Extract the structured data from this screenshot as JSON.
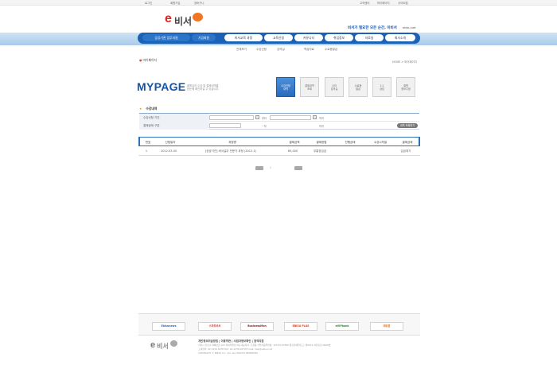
{
  "top_links": [
    "로그인",
    "회원가입",
    "장바구니",
    "고객센터",
    "마이페이지",
    "사이트맵"
  ],
  "brand": {
    "logo_e": "e",
    "logo_name": "비서"
  },
  "slogan": "비서가 필요한 모든 순간, 이비서",
  "slogan_sub": "ebisu.net",
  "nav": [
    {
      "label": "공공기관 업무지원",
      "style": "dark"
    },
    {
      "label": "기업회원",
      "style": "dark"
    },
    {
      "label": "비서교육 과정",
      "style": "light"
    },
    {
      "label": "교육신청",
      "style": "light"
    },
    {
      "label": "커뮤니티",
      "style": "light"
    },
    {
      "label": "취업정보",
      "style": "light"
    },
    {
      "label": "자료실",
      "style": "light"
    },
    {
      "label": "회사소개",
      "style": "light"
    }
  ],
  "subnav": [
    "전체보기",
    "수강신청",
    "강의실",
    "학습자료",
    "수료증발급"
  ],
  "breadcrumb": {
    "left": "마이페이지",
    "right": "HOME > 마이페이지"
  },
  "page": {
    "title": "MYPAGE",
    "desc_line1": "회원님의 수강 및 결제내역을",
    "desc_line2": "한눈에 확인하실 수 있습니다."
  },
  "tiles": [
    {
      "label1": "수강신청",
      "label2": "내역",
      "active": true
    },
    {
      "label1": "결제내역",
      "label2": "조회",
      "active": false
    },
    {
      "label1": "나의",
      "label2": "강의실",
      "active": false
    },
    {
      "label1": "수료증",
      "label2": "발급",
      "active": false
    },
    {
      "label1": "1:1",
      "label2": "상담",
      "active": false
    },
    {
      "label1": "회원",
      "label2": "정보수정",
      "active": false
    }
  ],
  "search": {
    "title": "수강내역",
    "row1_label": "수강신청 기간",
    "row1_from": "부터",
    "row1_to": "까지",
    "row2_label": "결제상태 구분",
    "row2_mid": "~부",
    "row2_end": "까지",
    "search_button": "내역 조회하기"
  },
  "table": {
    "headers": [
      "번호",
      "신청일자",
      "과정명",
      "결제금액",
      "결제방법",
      "진행상태",
      "수강시작일",
      "결제상태"
    ],
    "rows": [
      [
        "1",
        "2012.03.05",
        "[공공기관] 비서실무 전문가 과정 (2012-1)",
        "85,000",
        "무통장입금",
        "",
        "",
        "입금대기"
      ]
    ]
  },
  "pager": {
    "label": "1"
  },
  "partners": [
    "Ebisunews",
    "스마트비서",
    "BusinessMan",
    "EBISU PLUS",
    "eVIPbank",
    "에듀팜"
  ],
  "footer": {
    "logo_e": "e",
    "logo_name": "비서",
    "links": "개인정보취급방침 | 이용약관 | 사업자정보확인 | 원격지원",
    "line1": "서울시 강남구 테헤란로 123 이비서빌딩 5층  대표이사: 홍길동  사업자등록번호: 123-45-67890  통신판매업신고: 제2012-서울강남-0000호",
    "line2": "고객센터: 02-1234-5678  FAX: 02-1234-5679  E-mail: help@ebisu.net",
    "line3": "COPYRIGHT © EBISU Co., Ltd. ALL RIGHTS RESERVED."
  }
}
